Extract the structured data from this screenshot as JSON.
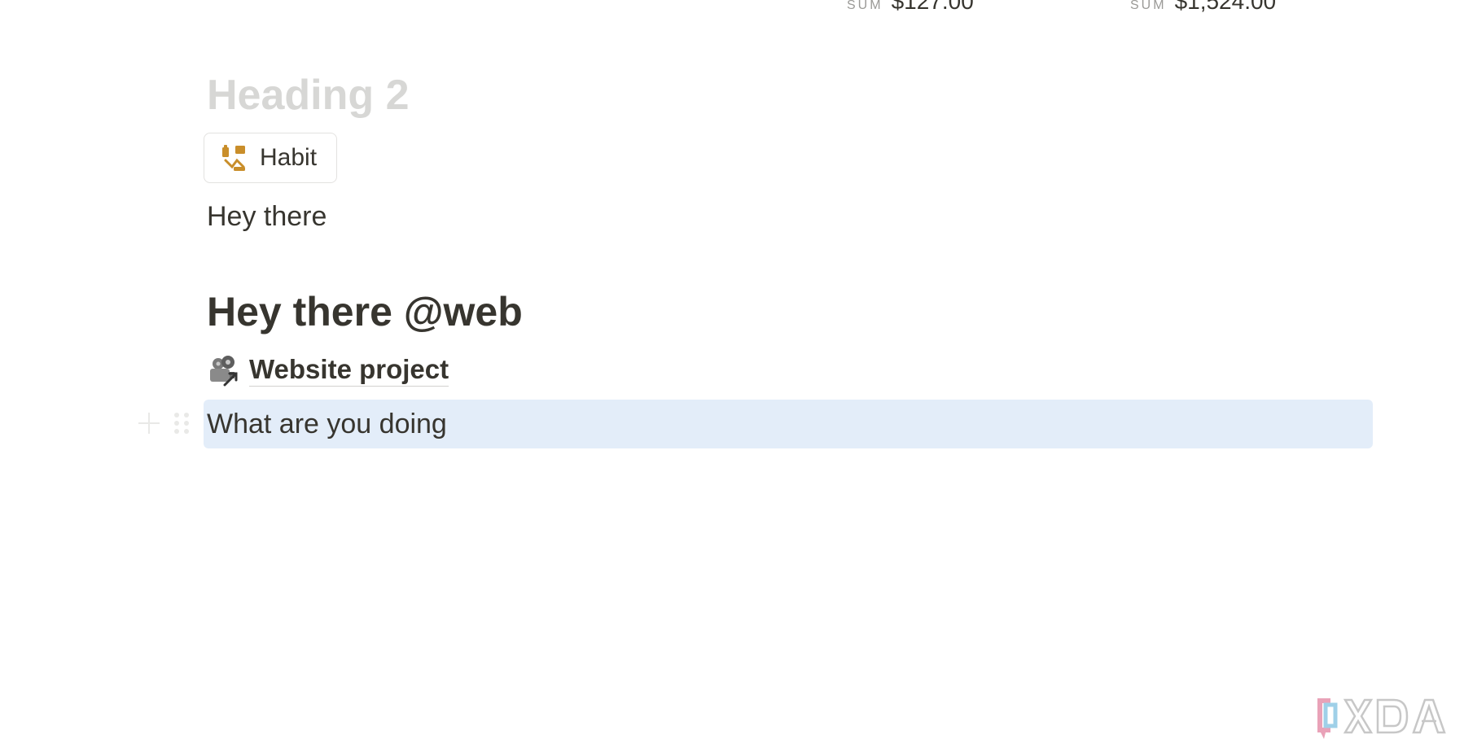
{
  "summary_row": [
    {
      "label": "SUM",
      "value": "$127.00"
    },
    {
      "label": "SUM",
      "value": "$1,524.00"
    }
  ],
  "blocks": {
    "heading_2_placeholder": "Heading 2",
    "page_chip": {
      "label": "Habit",
      "icon": "habit-icon"
    },
    "paragraph": "Hey there",
    "heading_1": "Hey there @web",
    "page_link": {
      "label": "Website project",
      "icon": "film-projector-icon"
    },
    "selected_paragraph": "What are you doing"
  },
  "block_handles": {
    "add_icon": "plus-icon",
    "drag_icon": "drag-handle-icon"
  },
  "watermark": {
    "logo": "XDA"
  },
  "colors": {
    "text": "#37352f",
    "placeholder": "#d7d7d5",
    "selection": "#e3edf9",
    "chip_border": "#e3e2e0",
    "habit_icon": "#c98e2a"
  }
}
